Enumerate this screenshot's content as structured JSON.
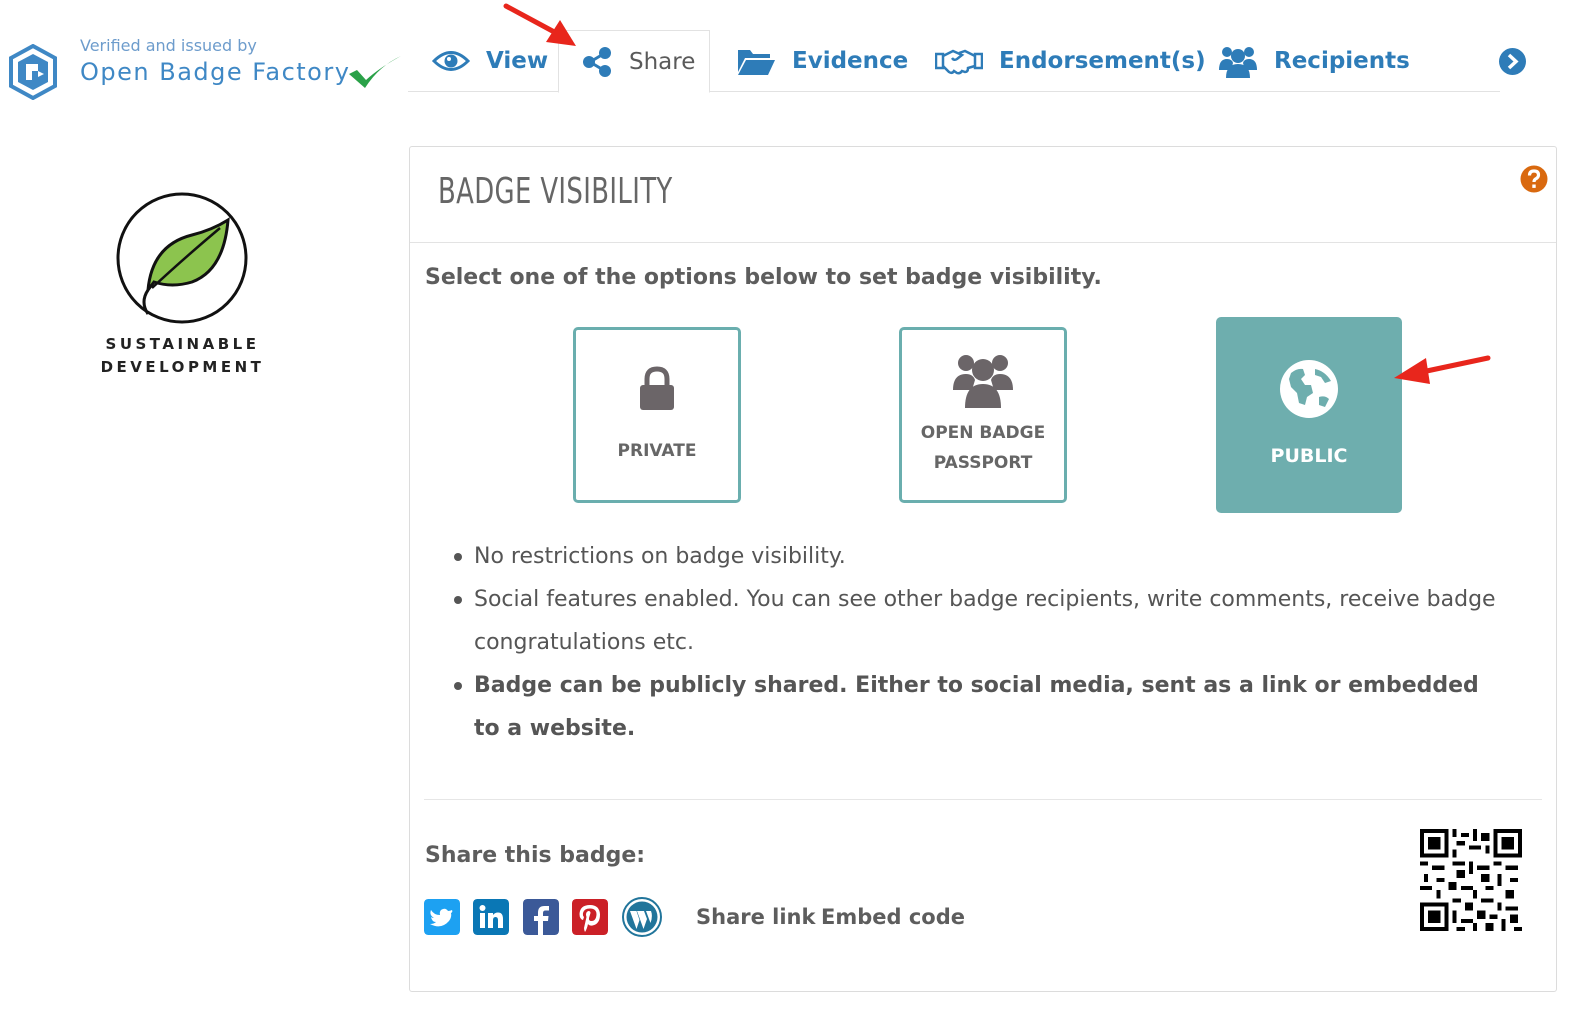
{
  "brand": {
    "verified_text": "Verified and issued by",
    "name": "Open Badge Factory",
    "logo_icon": "obf-cube-icon",
    "check_icon": "green-check-icon"
  },
  "tabs": [
    {
      "label": "View",
      "icon": "eye-icon",
      "active": false
    },
    {
      "label": "Share",
      "icon": "share-icon",
      "active": true
    },
    {
      "label": "Evidence",
      "icon": "folder-open-icon",
      "active": false
    },
    {
      "label": "Endorsement(s)",
      "icon": "handshake-icon",
      "active": false
    },
    {
      "label": "Recipients",
      "icon": "users-icon",
      "active": false
    }
  ],
  "badge": {
    "caption_line1": "SUSTAINABLE",
    "caption_line2": "DEVELOPMENT",
    "icon": "leaf-icon"
  },
  "panel": {
    "title": "BADGE VISIBILITY",
    "instruction": "Select one of the options below to set badge visibility.",
    "options": [
      {
        "label": "PRIVATE",
        "icon": "lock-icon",
        "selected": false
      },
      {
        "label_line1": "OPEN BADGE",
        "label_line2": "PASSPORT",
        "icon": "users-icon",
        "selected": false
      },
      {
        "label": "PUBLIC",
        "icon": "globe-icon",
        "selected": true
      }
    ],
    "bullets": [
      "No restrictions on badge visibility.",
      "Social features enabled. You can see other badge recipients, write comments, receive badge congratulations etc.",
      "Badge can be publicly shared. Either to social media, sent as a link or embedded to a website."
    ],
    "share_title": "Share this badge:",
    "social_icons": [
      "twitter-icon",
      "linkedin-icon",
      "facebook-icon",
      "pinterest-icon",
      "wordpress-icon"
    ],
    "share_link_label": "Share link",
    "embed_code_label": "Embed code"
  },
  "colors": {
    "tab_blue": "#2e7cb8",
    "teal": "#6eaeae",
    "arrow_red": "#e8261c",
    "help_orange": "#d9690f"
  }
}
